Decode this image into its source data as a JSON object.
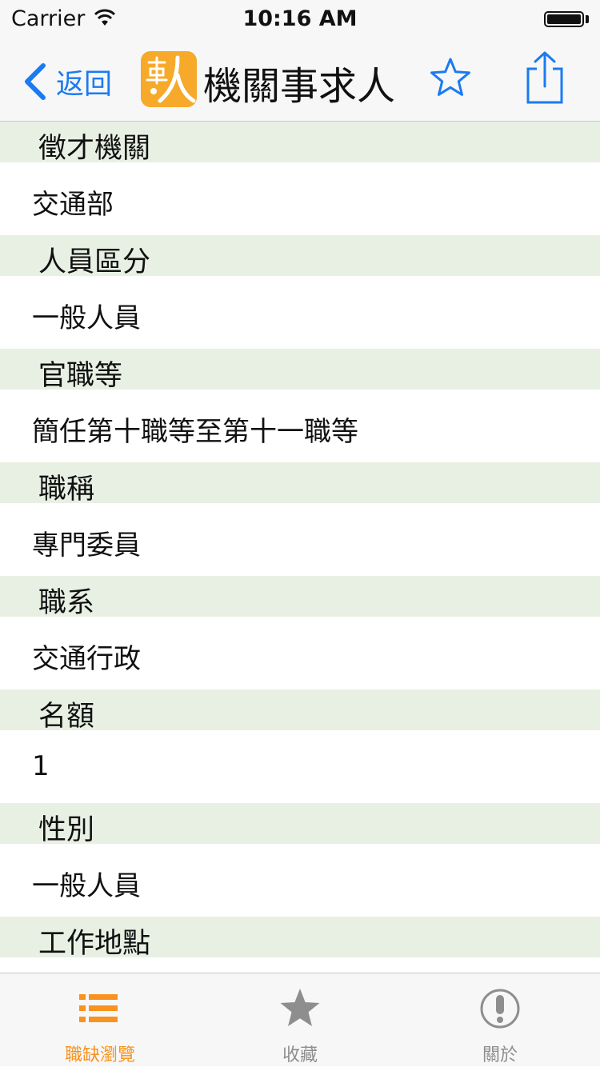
{
  "status_bar": {
    "carrier": "Carrier",
    "time": "10:16 AM",
    "battery_level": 1.0
  },
  "nav": {
    "back_label": "返回",
    "logo_icon": "app-logo-icon",
    "title": "機關事求人",
    "favorite_icon": "star-outline-icon",
    "share_icon": "share-icon",
    "accent_color": "#1a7bf2"
  },
  "sections": [
    {
      "header": "徵才機關",
      "value": "交通部"
    },
    {
      "header": "人員區分",
      "value": "一般人員"
    },
    {
      "header": "官職等",
      "value": "簡任第十職等至第十一職等"
    },
    {
      "header": "職稱",
      "value": "專門委員"
    },
    {
      "header": "職系",
      "value": "交通行政"
    },
    {
      "header": "名額",
      "value": "1"
    },
    {
      "header": "性別",
      "value": "一般人員"
    },
    {
      "header": "工作地點",
      "value": ""
    }
  ],
  "tab_bar": {
    "tabs": [
      {
        "label": "職缺瀏覽",
        "icon": "list-icon",
        "active": true
      },
      {
        "label": "收藏",
        "icon": "star-filled-icon",
        "active": false
      },
      {
        "label": "關於",
        "icon": "info-exclamation-icon",
        "active": false
      }
    ],
    "active_color": "#f7931e",
    "inactive_color": "#8e8e8e"
  },
  "colors": {
    "section_header_bg": "#e8f0e3",
    "bar_bg": "#f7f7f7"
  }
}
